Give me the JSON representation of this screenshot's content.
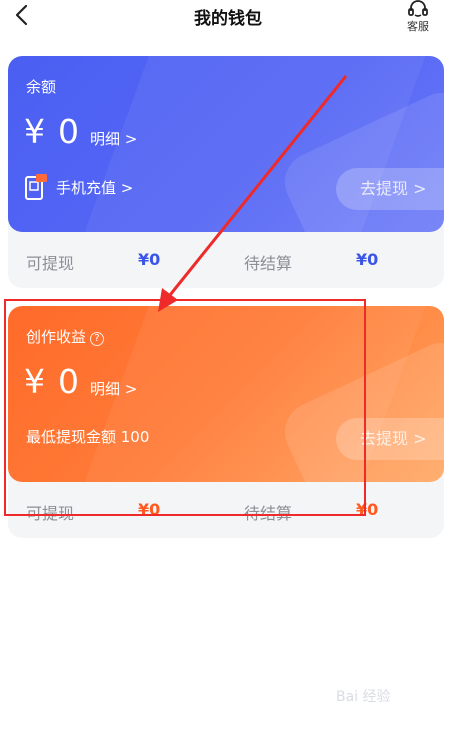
{
  "header": {
    "title": "我的钱包",
    "service_label": "客服"
  },
  "balance_card": {
    "label": "余额",
    "currency": "¥",
    "amount": "0",
    "detail": "明细 >",
    "recharge": "手机充值 >",
    "withdraw": "去提现 >",
    "stats": {
      "withdrawable_label": "可提现",
      "withdrawable_value": "¥0",
      "pending_label": "待结算",
      "pending_value": "¥0"
    }
  },
  "earnings_card": {
    "label": "创作收益",
    "help_glyph": "?",
    "currency": "¥",
    "amount": "0",
    "detail": "明细 >",
    "min_text": "最低提现金额 100",
    "withdraw": "去提现 >",
    "stats": {
      "withdrawable_label": "可提现",
      "withdrawable_value": "¥0",
      "pending_label": "待结算",
      "pending_value": "¥0"
    }
  },
  "colors": {
    "balance_accent": "#4a5ff2",
    "earnings_accent": "#ff6a2a",
    "annotation": "#ee2a2a"
  },
  "watermark": "Bai 经验"
}
